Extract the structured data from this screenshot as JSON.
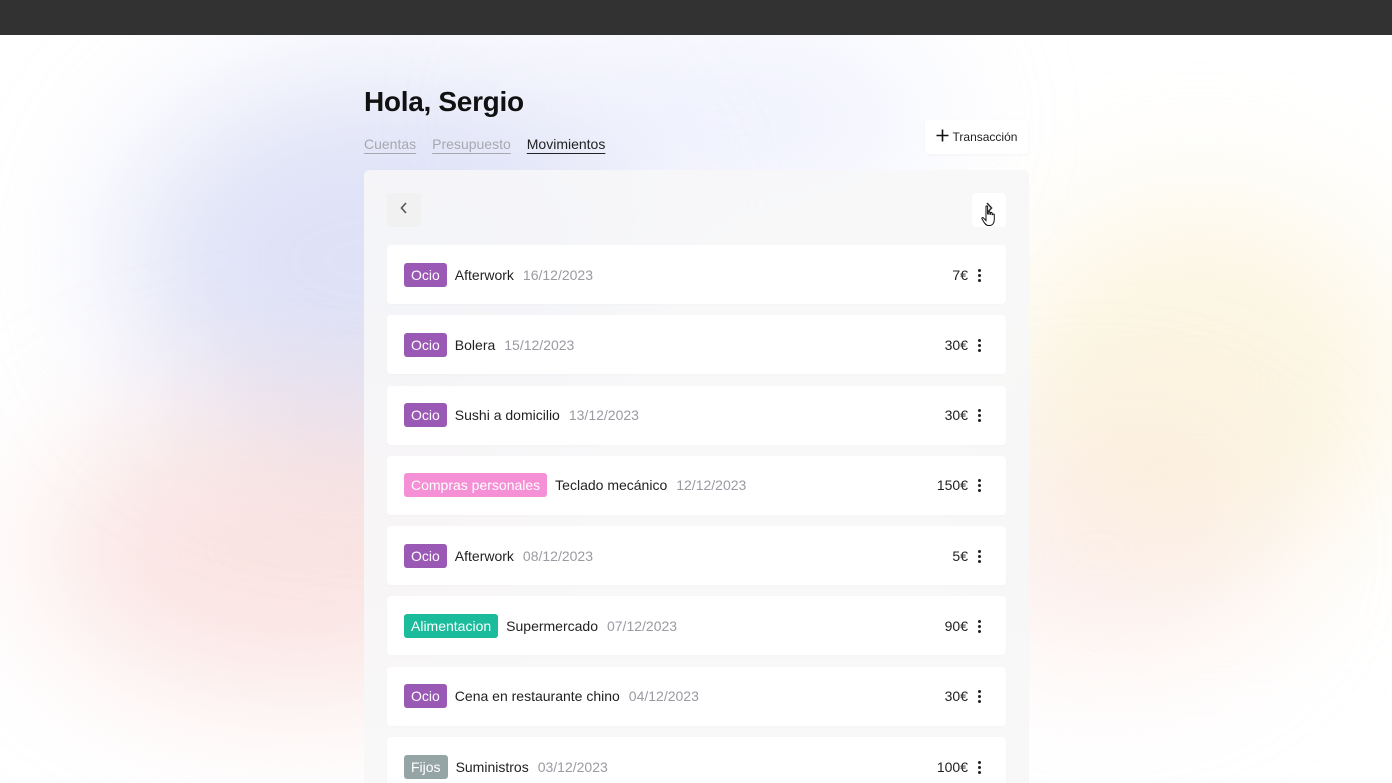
{
  "colors": {
    "topbar": "#323232",
    "ocio": "#9b59b6",
    "compras_personales": "#f58fd6",
    "alimentacion": "#1abc9c",
    "fijos": "#95a5a6"
  },
  "header": {
    "greeting": "Hola, Sergio",
    "tabs": [
      {
        "label": "Cuentas",
        "active": false
      },
      {
        "label": "Presupuesto",
        "active": false
      },
      {
        "label": "Movimientos",
        "active": true
      }
    ],
    "add_button_label": "Transacción",
    "add_button_icon": "plus-icon"
  },
  "pager": {
    "prev_icon": "chevron-left-icon",
    "next_icon": "chevron-right-icon"
  },
  "transactions": [
    {
      "category": "Ocio",
      "category_color": "#9b59b6",
      "name": "Afterwork",
      "date": "16/12/2023",
      "amount": "7€"
    },
    {
      "category": "Ocio",
      "category_color": "#9b59b6",
      "name": "Bolera",
      "date": "15/12/2023",
      "amount": "30€"
    },
    {
      "category": "Ocio",
      "category_color": "#9b59b6",
      "name": "Sushi a domicilio",
      "date": "13/12/2023",
      "amount": "30€"
    },
    {
      "category": "Compras personales",
      "category_color": "#f58fd6",
      "name": "Teclado mecánico",
      "date": "12/12/2023",
      "amount": "150€"
    },
    {
      "category": "Ocio",
      "category_color": "#9b59b6",
      "name": "Afterwork",
      "date": "08/12/2023",
      "amount": "5€"
    },
    {
      "category": "Alimentacion",
      "category_color": "#1abc9c",
      "name": "Supermercado",
      "date": "07/12/2023",
      "amount": "90€"
    },
    {
      "category": "Ocio",
      "category_color": "#9b59b6",
      "name": "Cena en restaurante chino",
      "date": "04/12/2023",
      "amount": "30€"
    },
    {
      "category": "Fijos",
      "category_color": "#95a5a6",
      "name": "Suministros",
      "date": "03/12/2023",
      "amount": "100€"
    }
  ]
}
